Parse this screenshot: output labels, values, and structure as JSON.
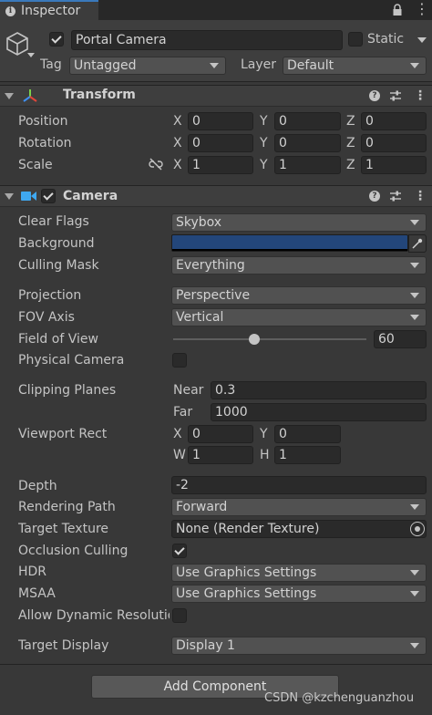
{
  "tab": {
    "label": "Inspector"
  },
  "gameobject": {
    "name": "Portal Camera",
    "static_label": "Static",
    "tag_label": "Tag",
    "tag_value": "Untagged",
    "layer_label": "Layer",
    "layer_value": "Default"
  },
  "transform": {
    "title": "Transform",
    "position": {
      "label": "Position",
      "x": "0",
      "y": "0",
      "z": "0"
    },
    "rotation": {
      "label": "Rotation",
      "x": "0",
      "y": "0",
      "z": "0"
    },
    "scale": {
      "label": "Scale",
      "x": "1",
      "y": "1",
      "z": "1"
    },
    "axis_x": "X",
    "axis_y": "Y",
    "axis_z": "Z"
  },
  "camera": {
    "title": "Camera",
    "clear_flags": {
      "label": "Clear Flags",
      "value": "Skybox"
    },
    "background": {
      "label": "Background",
      "color": "#23467a"
    },
    "culling_mask": {
      "label": "Culling Mask",
      "value": "Everything"
    },
    "projection": {
      "label": "Projection",
      "value": "Perspective"
    },
    "fov_axis": {
      "label": "FOV Axis",
      "value": "Vertical"
    },
    "field_of_view": {
      "label": "Field of View",
      "value": "60",
      "slider_fraction": 0.42
    },
    "physical_camera": {
      "label": "Physical Camera"
    },
    "clipping_planes": {
      "label": "Clipping Planes",
      "near_label": "Near",
      "near": "0.3",
      "far_label": "Far",
      "far": "1000"
    },
    "viewport_rect": {
      "label": "Viewport Rect",
      "x_label": "X",
      "x": "0",
      "y_label": "Y",
      "y": "0",
      "w_label": "W",
      "w": "1",
      "h_label": "H",
      "h": "1"
    },
    "depth": {
      "label": "Depth",
      "value": "-2"
    },
    "rendering_path": {
      "label": "Rendering Path",
      "value": "Forward"
    },
    "target_texture": {
      "label": "Target Texture",
      "value": "None (Render Texture)"
    },
    "occlusion_culling": {
      "label": "Occlusion Culling"
    },
    "hdr": {
      "label": "HDR",
      "value": "Use Graphics Settings"
    },
    "msaa": {
      "label": "MSAA",
      "value": "Use Graphics Settings"
    },
    "dynamic_resolution": {
      "label": "Allow Dynamic Resolution"
    },
    "target_display": {
      "label": "Target Display",
      "value": "Display 1"
    }
  },
  "add_component": {
    "label": "Add Component"
  },
  "watermark": {
    "text": "CSDN @kzchenguanzhou"
  },
  "colors": {
    "accent": "#3a79bb",
    "background": "#383838",
    "panel": "#3e3e3e"
  }
}
